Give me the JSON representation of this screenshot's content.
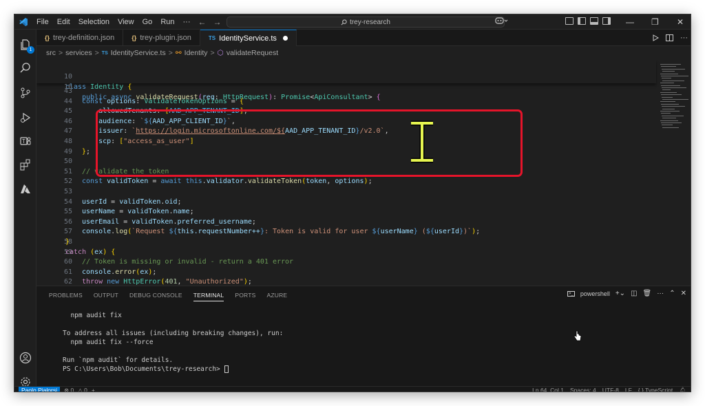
{
  "menu": [
    "File",
    "Edit",
    "Selection",
    "View",
    "Go",
    "Run",
    "···"
  ],
  "nav": {
    "back": "←",
    "forward": "→"
  },
  "search": {
    "placeholder": "trey-research"
  },
  "window_controls": {
    "minimize": "—",
    "restore": "❐",
    "close": "✕"
  },
  "activity": {
    "explorer_badge": "1"
  },
  "tabs": [
    {
      "icon": "{}",
      "label": "trey-definition.json"
    },
    {
      "icon": "{}",
      "label": "trey-plugin.json"
    },
    {
      "icon": "TS",
      "label": "IdentityService.ts"
    }
  ],
  "breadcrumb": {
    "p0": "src",
    "p1": "services",
    "p2_icon": "TS",
    "p2": "IdentityService.ts",
    "p3": "Identity",
    "p4": "validateRequest",
    "sep": ">"
  },
  "sticky_lines": [
    {
      "num": "10",
      "code": "class Identity {"
    },
    {
      "num": "16",
      "code": "    public async validateRequest(req: HttpRequest): Promise<ApiConsultant> {"
    }
  ],
  "code_lines": [
    {
      "num": "43",
      "code": ""
    },
    {
      "num": "44",
      "code": "const options: ValidateTokenOptions = {"
    },
    {
      "num": "45",
      "code": "    allowedTenants: [AAD_APP_TENANT_ID],"
    },
    {
      "num": "46",
      "code": "    audience: `${AAD_APP_CLIENT_ID}`,"
    },
    {
      "num": "47",
      "code": "    issuer: `https://login.microsoftonline.com/${AAD_APP_TENANT_ID}/v2.0`,"
    },
    {
      "num": "48",
      "code": "    scp: [\"access_as_user\"]"
    },
    {
      "num": "49",
      "code": "};"
    },
    {
      "num": "50",
      "code": ""
    },
    {
      "num": "51",
      "code": "// validate the token"
    },
    {
      "num": "52",
      "code": "const validToken = await this.validator.validateToken(token, options);"
    },
    {
      "num": "53",
      "code": ""
    },
    {
      "num": "54",
      "code": "userId = validToken.oid;"
    },
    {
      "num": "55",
      "code": "userName = validToken.name;"
    },
    {
      "num": "56",
      "code": "userEmail = validToken.preferred_username;"
    },
    {
      "num": "57",
      "code": "console.log(`Request ${this.requestNumber++}: Token is valid for user ${userName} (${userId})`);"
    },
    {
      "num": "58",
      "code": "}"
    },
    {
      "num": "59",
      "code": "catch (ex) {"
    },
    {
      "num": "60",
      "code": "// Token is missing or invalid - return a 401 error"
    },
    {
      "num": "61",
      "code": "console.error(ex);"
    },
    {
      "num": "62",
      "code": "throw new HttpError(401, \"Unauthorized\");"
    }
  ],
  "panel": {
    "tabs": [
      "PROBLEMS",
      "OUTPUT",
      "DEBUG CONSOLE",
      "TERMINAL",
      "PORTS",
      "AZURE"
    ],
    "active_tab": "TERMINAL",
    "shell": "powershell",
    "terminal_lines": [
      "  npm audit fix",
      "",
      "To address all issues (including breaking changes), run:",
      "  npm audit fix --force",
      "",
      "Run `npm audit` for details.",
      "PS C:\\Users\\Bob\\Documents\\trey-research> "
    ]
  },
  "status": {
    "user": "Paolo Pialorsi",
    "errors": "⊗ 0",
    "warnings": "△ 0",
    "position": "Ln 64, Col 1",
    "spaces": "Spaces: 4",
    "encoding": "UTF-8",
    "eol": "LF",
    "language": "{ } TypeScript"
  },
  "colors": {
    "accent": "#0078d4",
    "highlight": "#e5142a",
    "cursor": "#e6f550"
  }
}
